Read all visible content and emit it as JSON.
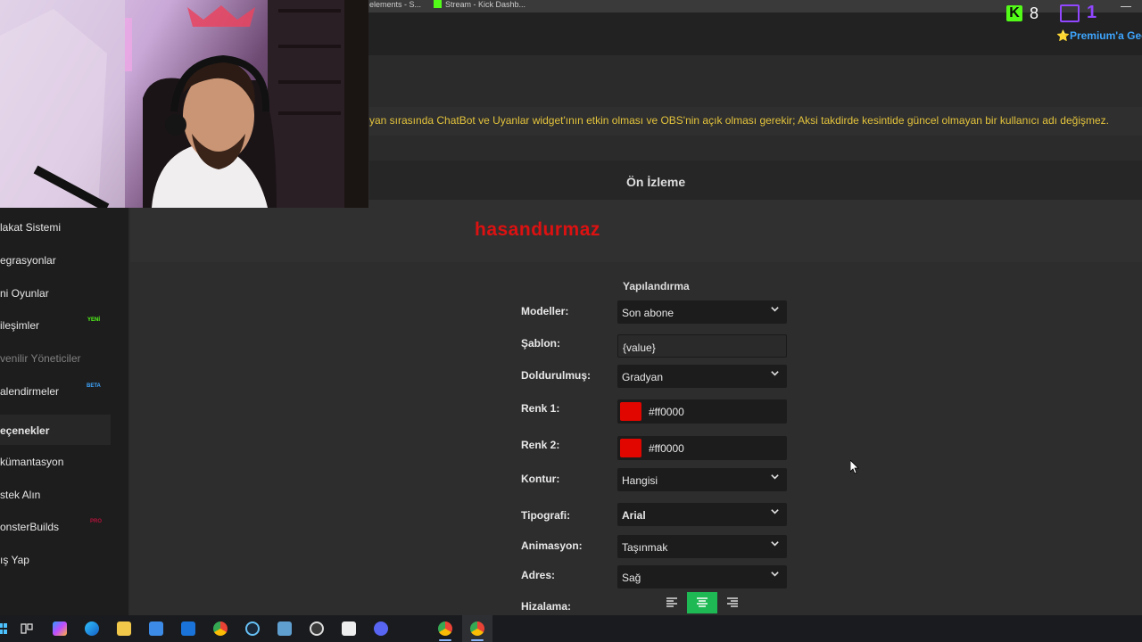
{
  "browser": {
    "tabs": [
      {
        "label": "elements - S..."
      },
      {
        "label": "Stream - Kick Dashb..."
      }
    ]
  },
  "topbar": {
    "kick_logo_letter": "K",
    "kick_count": "8",
    "twitch_count": "1",
    "premium_label": "⭐Premium'a Geç"
  },
  "notice": "yan sırasında ChatBot ve Uyanlar widget'ının etkin olması ve OBS'nin açık olması gerekir; Aksi takdirde kesintide güncel olmayan bir kullanıcı adı değişmez.",
  "preview": {
    "title": "Ön İzleme",
    "name": "hasandurmaz"
  },
  "sidebar": {
    "items": [
      {
        "label": "lakat Sistemi"
      },
      {
        "label": "egrasyonlar"
      },
      {
        "label": "ni Oyunlar"
      },
      {
        "label": "ileşimler",
        "badge": "YENİ"
      },
      {
        "label": "venilir Yöneticiler"
      },
      {
        "label": "alendirmeler",
        "badge": "BETA"
      },
      {
        "label": "eçenekler"
      },
      {
        "label": "kümantasyon"
      },
      {
        "label": "stek Alın"
      },
      {
        "label": "onsterBuilds",
        "badge": "PRO"
      },
      {
        "label": "ış Yap"
      }
    ]
  },
  "config": {
    "title": "Yapılandırma",
    "fields": {
      "models": {
        "label": "Modeller:",
        "value": "Son abone"
      },
      "template": {
        "label": "Şablon:",
        "value": "{value}"
      },
      "fill": {
        "label": "Doldurulmuş:",
        "value": "Gradyan"
      },
      "color1": {
        "label": "Renk 1:",
        "value": "#ff0000"
      },
      "color2": {
        "label": "Renk 2:",
        "value": "#ff0000"
      },
      "outline": {
        "label": "Kontur:",
        "value": "Hangisi"
      },
      "typography": {
        "label": "Tipografi:",
        "value": "Arial"
      },
      "animation": {
        "label": "Animasyon:",
        "value": "Taşınmak"
      },
      "address": {
        "label": "Adres:",
        "value": "Sağ"
      },
      "alignment": {
        "label": "Hizalama:",
        "selected": "center"
      }
    }
  },
  "colors": {
    "accent_green": "#1eb954",
    "notice_yellow": "#e3c33c",
    "preview_red": "#dd1111",
    "swatch_red": "#e10600",
    "kick_green": "#53fc18",
    "twitch_purple": "#9146ff"
  },
  "taskbar": {
    "icons": [
      "start-icon",
      "task-view-icon",
      "copilot-icon",
      "edge-icon",
      "file-explorer-icon",
      "store-icon",
      "outlook-icon",
      "chrome-icon",
      "steam-icon",
      "media-icon",
      "obs-icon",
      "capture-icon",
      "discord-icon",
      "chrome-profile-icon",
      "chrome-active-icon"
    ]
  }
}
